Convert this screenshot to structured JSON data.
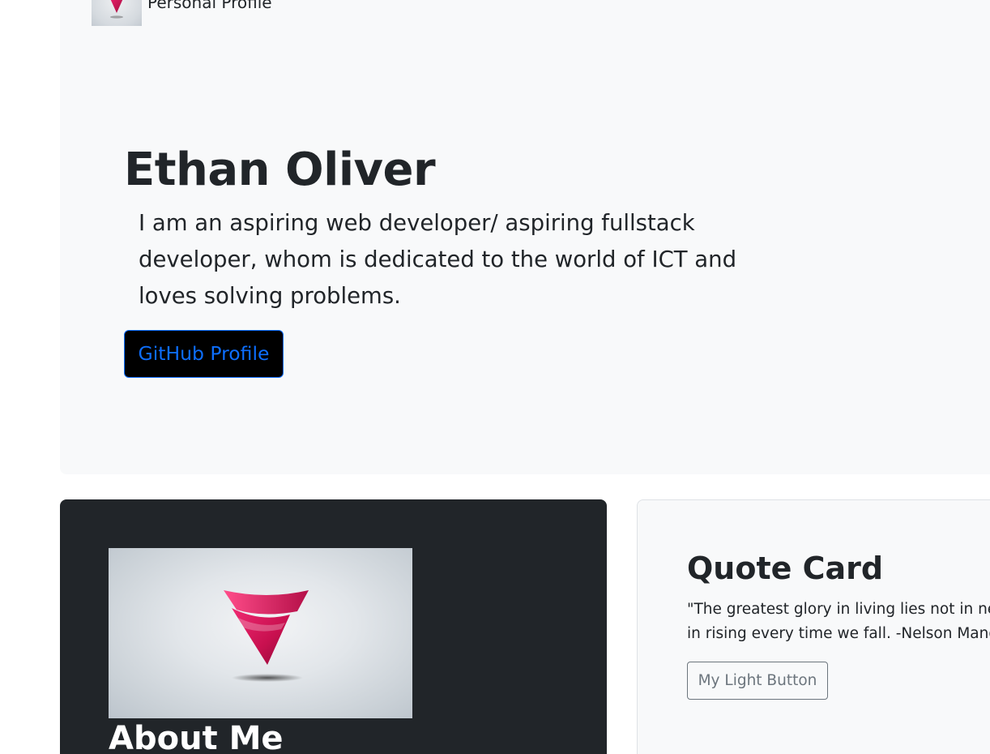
{
  "navbar": {
    "brand": "Personal Profile",
    "logo_icon": "v-logo-icon"
  },
  "hero": {
    "name": "Ethan Oliver",
    "lead": "I am an aspiring web developer/ aspiring fullstack developer, whom is dedicated to the world of ICT and loves solving problems.",
    "github_button": "GitHub Profile"
  },
  "about": {
    "title": "About Me",
    "image_icon": "v-logo-icon"
  },
  "quote": {
    "title": "Quote Card",
    "text": "\"The greatest glory in living lies not in never falling, but in rising every time we fall. -Nelson Mandela\"",
    "button": "My Light Button"
  },
  "colors": {
    "primary": "#0d6efd",
    "dark": "#212529",
    "light": "#f8f9fa",
    "secondary": "#6c757d",
    "logo_magenta": "#d6145f"
  }
}
